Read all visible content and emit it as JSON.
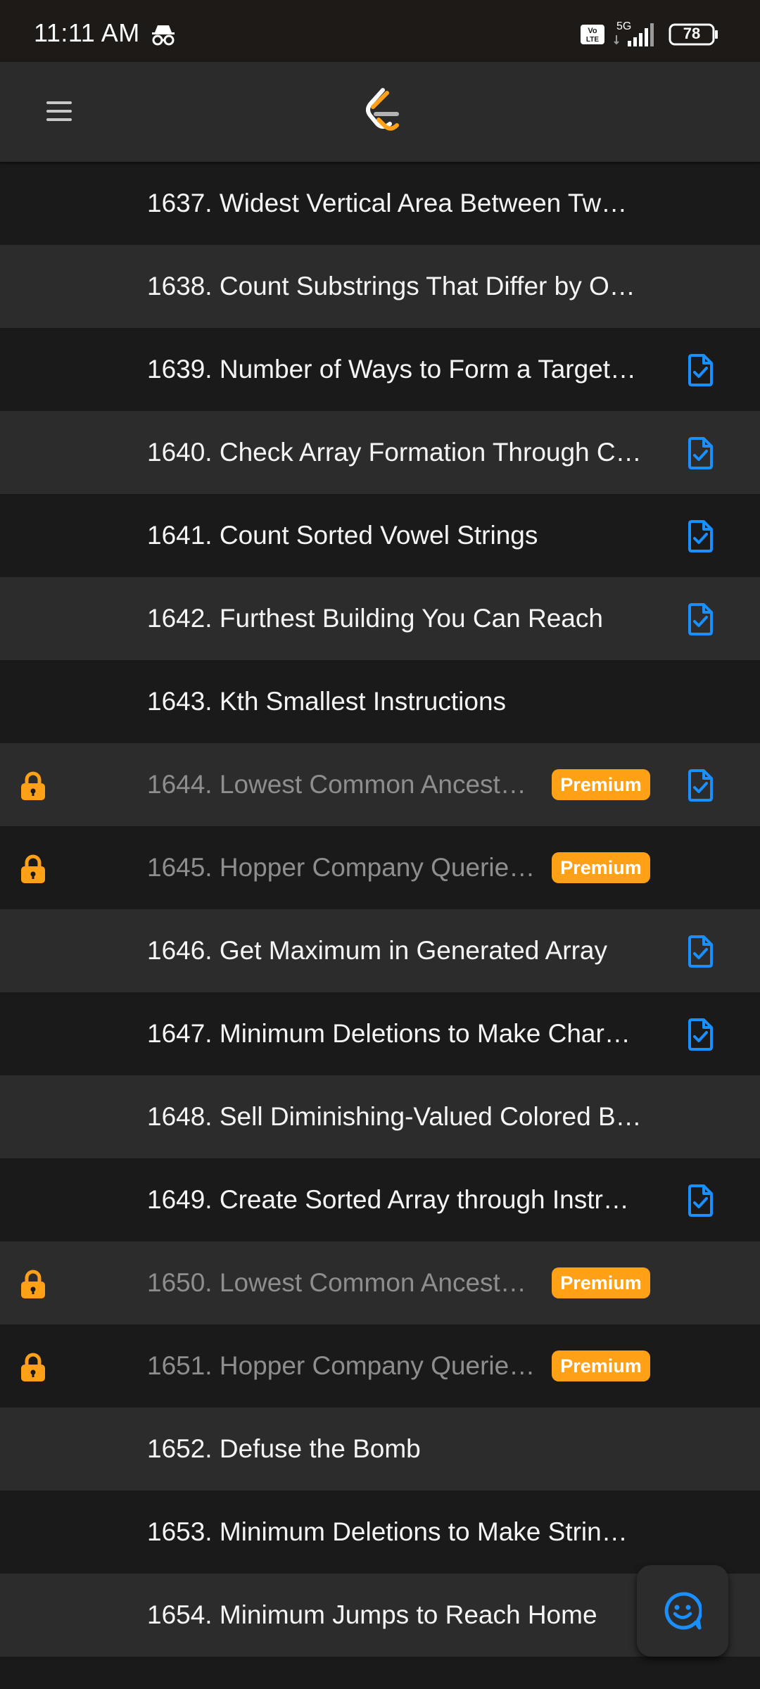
{
  "status_bar": {
    "time": "11:11 AM",
    "network": "5G",
    "volte": "Vo LTE",
    "battery": "78",
    "icons": [
      "incognito-icon",
      "volte-icon",
      "signal-icon",
      "battery-icon"
    ]
  },
  "app_bar": {
    "menu_icon": "hamburger-menu-icon",
    "logo": "leetcode-logo"
  },
  "colors": {
    "accent": "#ffa116",
    "solved_icon": "#1a90ff",
    "background_dark": "#1a1a1a",
    "background_light": "#2c2c2c",
    "locked_text": "#8e8e8e"
  },
  "premium_label": "Premium",
  "problems": [
    {
      "title": "1637. Widest Vertical Area Between Tw…",
      "locked": false,
      "premium": false,
      "solved": false
    },
    {
      "title": "1638. Count Substrings That Differ by O…",
      "locked": false,
      "premium": false,
      "solved": false
    },
    {
      "title": "1639. Number of Ways to Form a Target…",
      "locked": false,
      "premium": false,
      "solved": true
    },
    {
      "title": "1640. Check Array Formation Through C…",
      "locked": false,
      "premium": false,
      "solved": true
    },
    {
      "title": "1641. Count Sorted Vowel Strings",
      "locked": false,
      "premium": false,
      "solved": true
    },
    {
      "title": "1642. Furthest Building You Can Reach",
      "locked": false,
      "premium": false,
      "solved": true
    },
    {
      "title": "1643. Kth Smallest Instructions",
      "locked": false,
      "premium": false,
      "solved": false
    },
    {
      "title": "1644. Lowest Common Ancest…",
      "locked": true,
      "premium": true,
      "solved": true
    },
    {
      "title": "1645. Hopper Company Querie…",
      "locked": true,
      "premium": true,
      "solved": false
    },
    {
      "title": "1646. Get Maximum in Generated Array",
      "locked": false,
      "premium": false,
      "solved": true
    },
    {
      "title": "1647. Minimum Deletions to Make Char…",
      "locked": false,
      "premium": false,
      "solved": true
    },
    {
      "title": "1648. Sell Diminishing-Valued Colored B…",
      "locked": false,
      "premium": false,
      "solved": false
    },
    {
      "title": "1649. Create Sorted Array through Instr…",
      "locked": false,
      "premium": false,
      "solved": true
    },
    {
      "title": "1650. Lowest Common Ancest…",
      "locked": true,
      "premium": true,
      "solved": false
    },
    {
      "title": "1651. Hopper Company Querie…",
      "locked": true,
      "premium": true,
      "solved": false
    },
    {
      "title": "1652. Defuse the Bomb",
      "locked": false,
      "premium": false,
      "solved": false
    },
    {
      "title": "1653. Minimum Deletions to Make Strin…",
      "locked": false,
      "premium": false,
      "solved": false
    },
    {
      "title": "1654. Minimum Jumps to Reach Home",
      "locked": false,
      "premium": false,
      "solved": false
    }
  ],
  "fab": {
    "icon": "smiley-chat-icon"
  }
}
